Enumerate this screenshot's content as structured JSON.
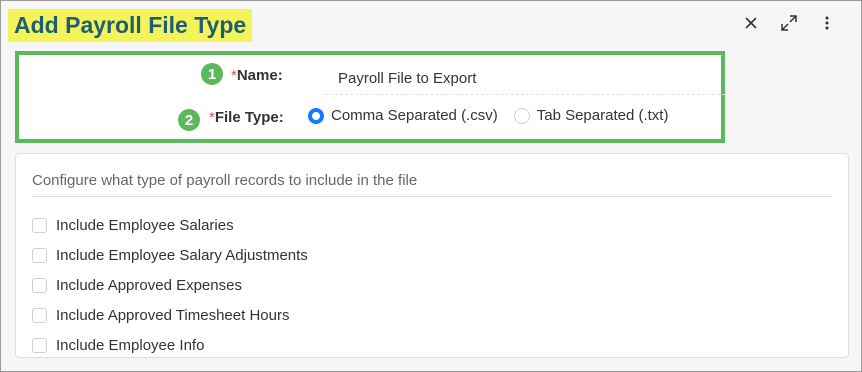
{
  "dialog": {
    "title": "Add Payroll File Type",
    "header_icons": [
      "close-icon",
      "expand-icon",
      "more-vertical-icon"
    ]
  },
  "form": {
    "name": {
      "badge": "1",
      "required_mark": "*",
      "label": "Name:",
      "value": "Payroll File to Export"
    },
    "file_type": {
      "badge": "2",
      "required_mark": "*",
      "label": "File Type:",
      "options": [
        {
          "label": "Comma Separated (.csv)",
          "selected": true
        },
        {
          "label": "Tab Separated (.txt)",
          "selected": false
        }
      ]
    }
  },
  "records": {
    "heading": "Configure what type of payroll records to include in the file",
    "items": [
      {
        "label": "Include Employee Salaries",
        "checked": false
      },
      {
        "label": "Include Employee Salary Adjustments",
        "checked": false
      },
      {
        "label": "Include Approved Expenses",
        "checked": false
      },
      {
        "label": "Include Approved Timesheet Hours",
        "checked": false
      },
      {
        "label": "Include Employee Info",
        "checked": false
      }
    ]
  },
  "colors": {
    "title_highlight": "#f4f35a",
    "title_text": "#1e5e74",
    "callout_green": "#5cb85c",
    "radio_selected": "#1677ff",
    "required": "#d9534f"
  }
}
